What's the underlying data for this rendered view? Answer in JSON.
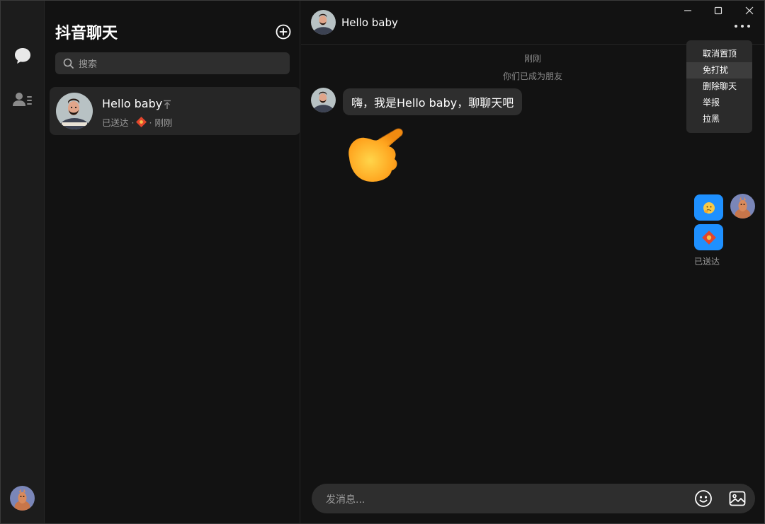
{
  "sidebar": {
    "icons": [
      "chat-bubble-icon",
      "contacts-icon"
    ]
  },
  "conversation_list": {
    "title": "抖音聊天",
    "search_placeholder": "搜索",
    "items": [
      {
        "name": "Hello baby",
        "status": "已送达 ·",
        "time": "· 刚刚",
        "pinned": true
      }
    ]
  },
  "chat": {
    "header_name": "Hello baby",
    "timestamp": "刚刚",
    "system_notice": "你们已成为朋友",
    "incoming_text": "嗨，我是Hello baby，聊聊天吧",
    "sent_status": "已送达",
    "composer_placeholder": "发消息..."
  },
  "menu": {
    "items": [
      "取消置顶",
      "免打扰",
      "删除聊天",
      "举报",
      "拉黑"
    ],
    "highlighted_index": 1
  },
  "colors": {
    "accent_blue": "#1e90ff",
    "background": "#121212",
    "panel": "#1c1c1c",
    "bubble": "#2e2e2e"
  }
}
